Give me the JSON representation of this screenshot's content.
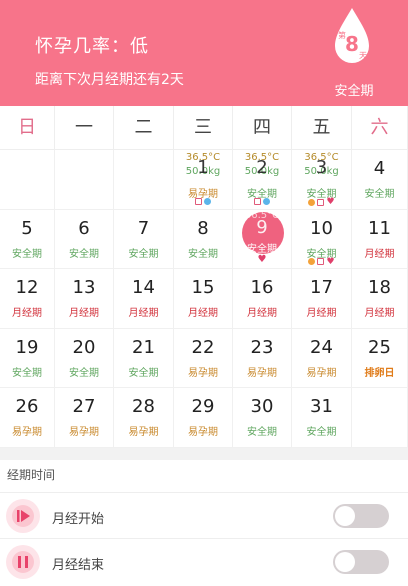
{
  "header": {
    "pregnancy_rate": "怀孕几率：低",
    "countdown": "距离下次月经期还有2天",
    "drop_prefix": "第",
    "drop_number": "8",
    "drop_suffix": "天",
    "drop_status": "安全期",
    "colors": {
      "background": "#f7748a",
      "text": "#ffffff"
    }
  },
  "weekdays": [
    "日",
    "一",
    "二",
    "三",
    "四",
    "五",
    "六"
  ],
  "calendar": {
    "weeks": [
      [
        {
          "day": "",
          "status": ""
        },
        {
          "day": "",
          "status": ""
        },
        {
          "day": "",
          "status": ""
        },
        {
          "day": "1",
          "status": "易孕期",
          "temp": "36.5°C",
          "weight": "50.0kg",
          "icons": [
            "note",
            "blue"
          ]
        },
        {
          "day": "2",
          "status": "安全期",
          "temp": "36.5°C",
          "weight": "50.0kg",
          "icons": [
            "note",
            "blue"
          ]
        },
        {
          "day": "3",
          "status": "安全期",
          "temp": "36.5°C",
          "weight": "50.0kg",
          "icons": [
            "orange",
            "note",
            "heart"
          ]
        },
        {
          "day": "4",
          "status": "安全期"
        }
      ],
      [
        {
          "day": "5",
          "status": "安全期"
        },
        {
          "day": "6",
          "status": "安全期"
        },
        {
          "day": "7",
          "status": "安全期"
        },
        {
          "day": "8",
          "status": "安全期"
        },
        {
          "day": "9",
          "status": "安全期",
          "today": true,
          "temp": "36.5°C"
        },
        {
          "day": "10",
          "status": "安全期",
          "icons": [
            "orange",
            "note",
            "heart"
          ]
        },
        {
          "day": "11",
          "status": "月经期"
        }
      ],
      [
        {
          "day": "12",
          "status": "月经期"
        },
        {
          "day": "13",
          "status": "月经期"
        },
        {
          "day": "14",
          "status": "月经期"
        },
        {
          "day": "15",
          "status": "月经期"
        },
        {
          "day": "16",
          "status": "月经期"
        },
        {
          "day": "17",
          "status": "月经期"
        },
        {
          "day": "18",
          "status": "月经期"
        }
      ],
      [
        {
          "day": "19",
          "status": "安全期"
        },
        {
          "day": "20",
          "status": "安全期"
        },
        {
          "day": "21",
          "status": "安全期"
        },
        {
          "day": "22",
          "status": "易孕期"
        },
        {
          "day": "23",
          "status": "易孕期"
        },
        {
          "day": "24",
          "status": "易孕期"
        },
        {
          "day": "25",
          "status": "排卵日"
        }
      ],
      [
        {
          "day": "26",
          "status": "易孕期"
        },
        {
          "day": "27",
          "status": "易孕期"
        },
        {
          "day": "28",
          "status": "易孕期"
        },
        {
          "day": "29",
          "status": "易孕期"
        },
        {
          "day": "30",
          "status": "安全期"
        },
        {
          "day": "31",
          "status": "安全期"
        },
        {
          "day": "",
          "status": ""
        }
      ]
    ],
    "status_colors": {
      "安全期": "#5fa65f",
      "月经期": "#d2323c",
      "易孕期": "#c98a2e",
      "排卵日": "#e07c1a"
    }
  },
  "period_settings": {
    "section_title": "经期时间",
    "start_label": "月经开始",
    "end_label": "月经结束",
    "start_icon": "play-icon",
    "end_icon": "pause-icon",
    "start_enabled": false,
    "end_enabled": false
  }
}
